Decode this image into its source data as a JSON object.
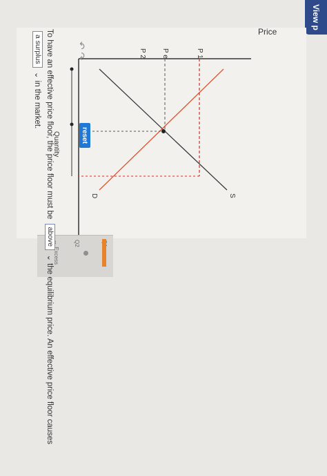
{
  "header": {
    "view_label": "View p"
  },
  "graph": {
    "ylabel": "Price",
    "xlabel": "Quantity",
    "price_labels": {
      "p1": "P 1",
      "pe": "P e",
      "p2": "P 2"
    },
    "curve_labels": {
      "supply": "S",
      "demand": "D"
    },
    "reset_label": "reset"
  },
  "tools": {
    "q1": "Q1",
    "q2": "Q2",
    "excess": "Excess"
  },
  "question": {
    "sentence_part1": "To have an effective price floor, the price floor must be",
    "select1_value": "above",
    "sentence_part2": "the equilibrium price. An effective price floor causes",
    "select2_value": "a surplus",
    "sentence_part3": "in the market."
  },
  "colors": {
    "demand": "#e0532c",
    "supply": "#3a3a3a",
    "dashed_p1": "#cc2f2f",
    "reset": "#1f78d6",
    "accent_orange": "#e8822c"
  }
}
